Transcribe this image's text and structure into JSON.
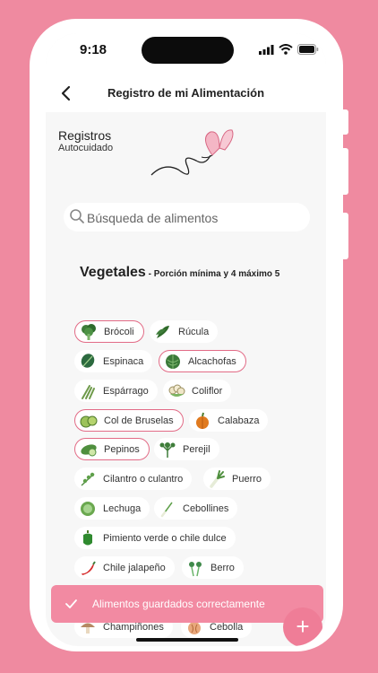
{
  "status_bar": {
    "time": "9:18"
  },
  "header": {
    "title": "Registro de mi Alimentación"
  },
  "summary": {
    "title": "Registros",
    "subtitle": "Autocuidado"
  },
  "search": {
    "placeholder": "Búsqueda de alimentos"
  },
  "category": {
    "name": "Vegetales",
    "detail": " - Porción mínima y 4 máximo 5"
  },
  "foods": [
    {
      "label": "Brócoli",
      "selected": true,
      "icon": "broccoli-icon"
    },
    {
      "label": "Rúcula",
      "selected": false,
      "icon": "arugula-icon"
    },
    {
      "label": "Espinaca",
      "selected": false,
      "icon": "spinach-icon"
    },
    {
      "label": "Alcachofas",
      "selected": true,
      "icon": "artichoke-icon"
    },
    {
      "label": "Espárrago",
      "selected": false,
      "icon": "asparagus-icon"
    },
    {
      "label": "Coliflor",
      "selected": false,
      "icon": "cauliflower-icon"
    },
    {
      "label": "Col de Bruselas",
      "selected": true,
      "icon": "brussels-sprouts-icon"
    },
    {
      "label": "Calabaza",
      "selected": false,
      "icon": "pumpkin-icon"
    },
    {
      "label": "Pepinos",
      "selected": true,
      "icon": "cucumber-icon"
    },
    {
      "label": "Perejil",
      "selected": false,
      "icon": "parsley-icon"
    },
    {
      "label": "Cilantro o culantro",
      "selected": false,
      "icon": "cilantro-icon"
    },
    {
      "label": "Puerro",
      "selected": false,
      "icon": "leek-icon"
    },
    {
      "label": "Lechuga",
      "selected": false,
      "icon": "lettuce-icon"
    },
    {
      "label": "Cebollines",
      "selected": false,
      "icon": "scallion-icon"
    },
    {
      "label": "Pimiento verde o chile dulce",
      "selected": false,
      "icon": "green-pepper-icon"
    },
    {
      "label": "Chile jalapeño",
      "selected": false,
      "icon": "chili-icon"
    },
    {
      "label": "Berro",
      "selected": false,
      "icon": "watercress-icon"
    },
    {
      "label": "Champiñones",
      "selected": false,
      "icon": "mushroom-icon"
    },
    {
      "label": "Cebolla",
      "selected": false,
      "icon": "onion-icon"
    }
  ],
  "toast": {
    "message": "Alimentos guardados correctamente"
  },
  "fab": {
    "label": "+"
  },
  "colors": {
    "background": "#ef8aa0",
    "accent": "#f28aa2",
    "selected_border": "#e26b86"
  }
}
